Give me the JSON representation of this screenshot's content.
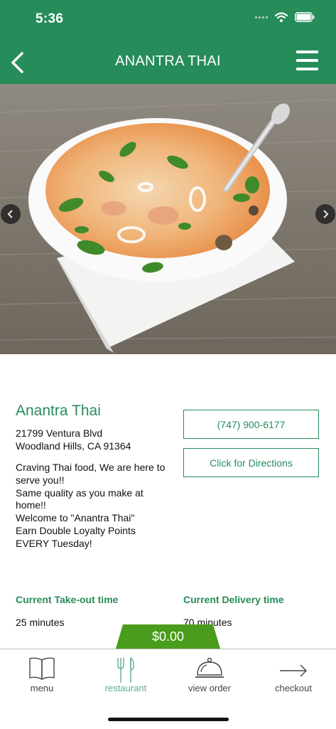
{
  "status_bar": {
    "time": "5:36"
  },
  "header": {
    "title": "ANANTRA THAI",
    "bg_color": "#268c5a"
  },
  "hero": {
    "description": "bowl of Thai soup with shrimp, lime and herbs on a wooden table"
  },
  "restaurant": {
    "name": "Anantra Thai",
    "address_line1": "21799 Ventura Blvd",
    "address_line2": "Woodland Hills, CA 91364",
    "description_lines": [
      "Craving Thai food, We are here to",
      "serve you!!",
      "Same quality as you make at",
      "home!!",
      "Welcome to \"Anantra Thai\"",
      "Earn Double Loyalty Points",
      "EVERY Tuesday!"
    ],
    "phone": "(747) 900-6177",
    "directions_label": "Click for Directions"
  },
  "times": {
    "takeout_label": "Current Take-out time",
    "takeout_value": "25 minutes",
    "delivery_label": "Current Delivery time",
    "delivery_value": "70 minutes"
  },
  "cart": {
    "total": "$0.00",
    "color": "#4a9c1c"
  },
  "tabbar": {
    "tabs": [
      {
        "label": "menu",
        "icon": "book-icon",
        "active": false
      },
      {
        "label": "restaurant",
        "icon": "fork-knife-icon",
        "active": true
      },
      {
        "label": "view order",
        "icon": "cloche-icon",
        "active": false
      },
      {
        "label": "checkout",
        "icon": "arrow-right-icon",
        "active": false
      }
    ],
    "active_color": "#5fae8a"
  }
}
